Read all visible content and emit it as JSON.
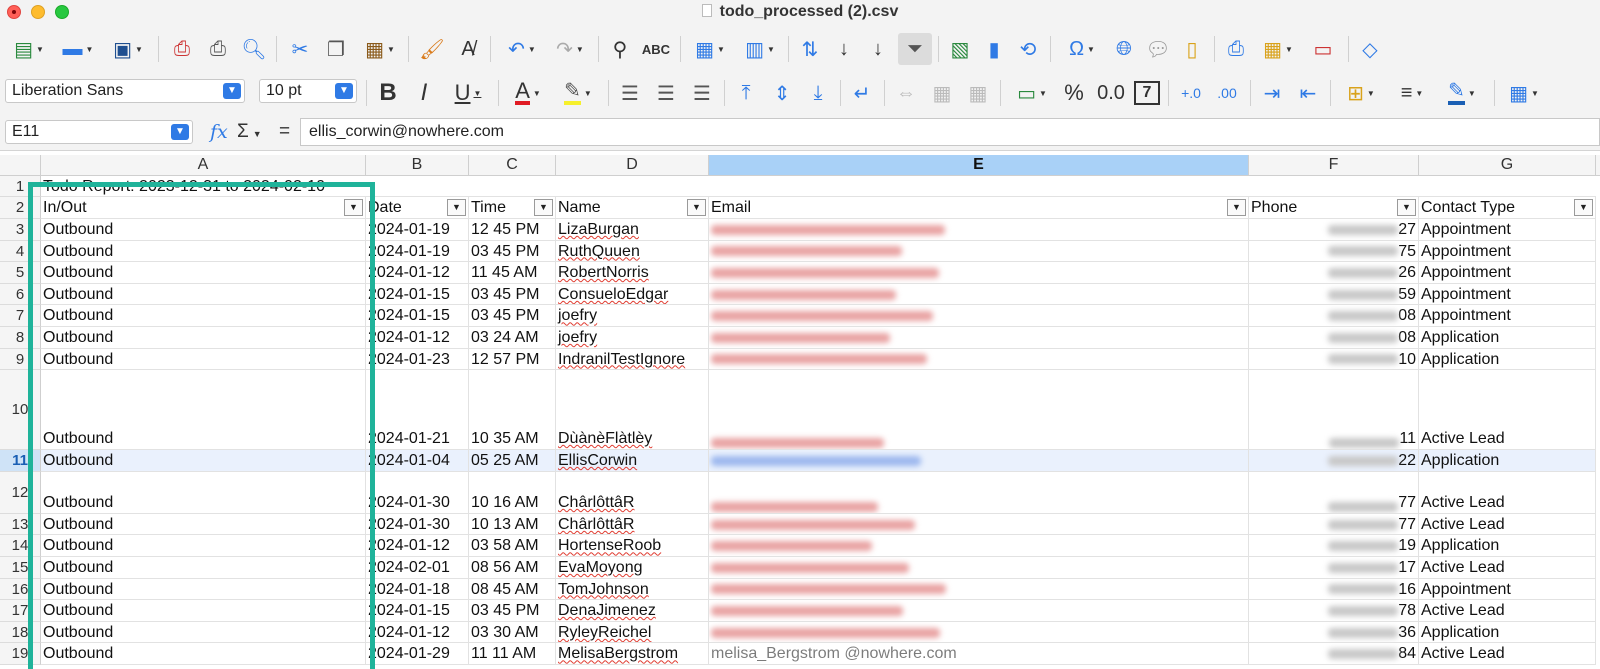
{
  "window": {
    "title": "todo_processed (2).csv"
  },
  "toolbar": {
    "font_name": "Liberation Sans",
    "font_size": "10 pt",
    "percent_label": "%",
    "decimal_label": "0.0",
    "number_label": "7"
  },
  "formula_bar": {
    "cell_ref": "E11",
    "fx_label": "fx",
    "sum_label": "Σ",
    "equals_label": "=",
    "value": "ellis_corwin@nowhere.com"
  },
  "sheet": {
    "selected_column": "E",
    "selected_row": "11",
    "columns": [
      "A",
      "B",
      "C",
      "D",
      "E",
      "F",
      "G"
    ],
    "title_row": "Todo Report: 2023-12-31 to 2024-02-10",
    "headers": [
      "In/Out",
      "Date",
      "Time",
      "Name",
      "Email",
      "Phone",
      "Contact Type"
    ],
    "rows": [
      {
        "num": "1"
      },
      {
        "num": "2"
      },
      {
        "num": "3",
        "inout": "Outbound",
        "date": "2024-01-19",
        "time": "12 45 PM",
        "name": "LizaBurgan",
        "phone_tail": "27",
        "type": "Appointment"
      },
      {
        "num": "4",
        "inout": "Outbound",
        "date": "2024-01-19",
        "time": "03 45 PM",
        "name": "RuthQuuen",
        "phone_tail": "75",
        "type": "Appointment"
      },
      {
        "num": "5",
        "inout": "Outbound",
        "date": "2024-01-12",
        "time": "11 45 AM",
        "name": "RobertNorris",
        "phone_tail": "26",
        "type": "Appointment"
      },
      {
        "num": "6",
        "inout": "Outbound",
        "date": "2024-01-15",
        "time": "03 45 PM",
        "name": "ConsueloEdgar",
        "phone_tail": "59",
        "type": "Appointment"
      },
      {
        "num": "7",
        "inout": "Outbound",
        "date": "2024-01-15",
        "time": "03 45 PM",
        "name": "joefry",
        "phone_tail": "08",
        "type": "Appointment"
      },
      {
        "num": "8",
        "inout": "Outbound",
        "date": "2024-01-12",
        "time": "03 24 AM",
        "name": "joefry",
        "phone_tail": "08",
        "type": "Application"
      },
      {
        "num": "9",
        "inout": "Outbound",
        "date": "2024-01-23",
        "time": "12 57 PM",
        "name": "IndranilTestIgnore",
        "phone_tail": "10",
        "type": "Application"
      },
      {
        "num": "10",
        "inout": "Outbound",
        "date": "2024-01-21",
        "time": "10 35 AM",
        "name": "DùànèFlàtlèy",
        "phone_tail": "11",
        "type": "Active Lead"
      },
      {
        "num": "11",
        "inout": "Outbound",
        "date": "2024-01-04",
        "time": "05 25 AM",
        "name": "EllisCorwin",
        "phone_tail": "22",
        "type": "Application"
      },
      {
        "num": "12",
        "inout": "Outbound",
        "date": "2024-01-30",
        "time": "10 16 AM",
        "name": "ChârlôttâR",
        "phone_tail": "77",
        "type": "Active Lead"
      },
      {
        "num": "13",
        "inout": "Outbound",
        "date": "2024-01-30",
        "time": "10 13 AM",
        "name": "ChârlôttâR",
        "phone_tail": "77",
        "type": "Active Lead"
      },
      {
        "num": "14",
        "inout": "Outbound",
        "date": "2024-01-12",
        "time": "03 58 AM",
        "name": "HortenseRoob",
        "phone_tail": "19",
        "type": "Application"
      },
      {
        "num": "15",
        "inout": "Outbound",
        "date": "2024-02-01",
        "time": "08 56 AM",
        "name": "EvaMoyong",
        "phone_tail": "17",
        "type": "Active Lead"
      },
      {
        "num": "16",
        "inout": "Outbound",
        "date": "2024-01-18",
        "time": "08 45 AM",
        "name": "TomJohnson",
        "phone_tail": "16",
        "type": "Appointment"
      },
      {
        "num": "17",
        "inout": "Outbound",
        "date": "2024-01-15",
        "time": "03 45 PM",
        "name": "DenaJimenez",
        "phone_tail": "78",
        "type": "Active Lead"
      },
      {
        "num": "18",
        "inout": "Outbound",
        "date": "2024-01-12",
        "time": "03 30 AM",
        "name": "RyleyReichel",
        "phone_tail": "36",
        "type": "Application"
      },
      {
        "num": "19",
        "inout": "Outbound",
        "date": "2024-01-29",
        "time": "11 11 AM",
        "name": "MelisaBergstrom",
        "phone_tail": "84",
        "type": "Active Lead",
        "email_partial": "melisa_Bergstrom @nowhere.com"
      }
    ]
  },
  "colors": {
    "highlight": "#1fb39a",
    "selection_header": "#a9d1f7",
    "accent": "#2f7ae5"
  }
}
